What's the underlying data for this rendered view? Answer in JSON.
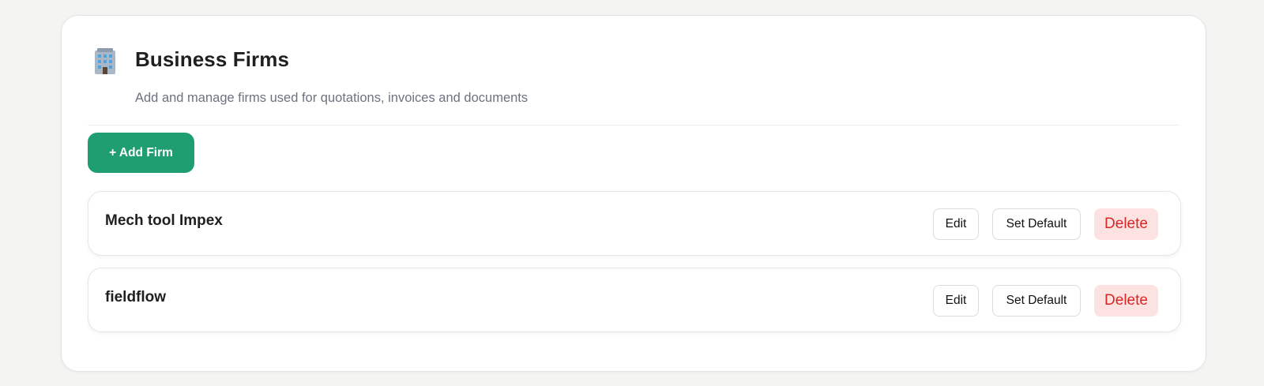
{
  "colors": {
    "accent": "#1f9e72",
    "danger": "#dc2626",
    "danger_bg": "#fde2e2"
  },
  "header": {
    "icon": "office-building-icon",
    "title": "Business Firms",
    "subtitle": "Add and manage firms used for quotations, invoices and documents"
  },
  "toolbar": {
    "add_label": "+ Add Firm"
  },
  "firms": [
    {
      "name": "Mech tool Impex",
      "edit_label": "Edit",
      "default_label": "Set Default",
      "delete_label": "Delete"
    },
    {
      "name": "fieldflow",
      "edit_label": "Edit",
      "default_label": "Set Default",
      "delete_label": "Delete"
    }
  ]
}
